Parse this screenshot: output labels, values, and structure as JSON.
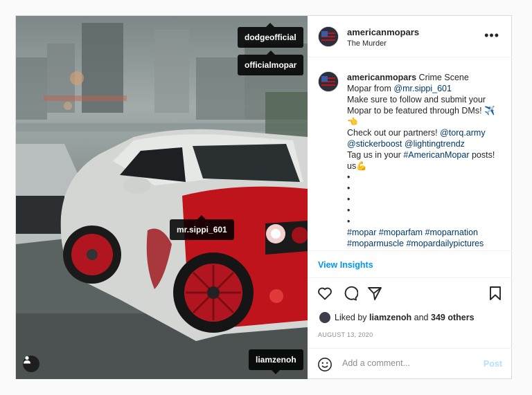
{
  "photo": {
    "tags": {
      "tag1": "dodgeofficial",
      "tag2": "officialmopar",
      "tag3": "mr.sippi_601",
      "tag4": "liamzenoh"
    },
    "user_tag_icon": "person-icon"
  },
  "header": {
    "username": "americanmopars",
    "location": "The Murder",
    "more_icon": "more-horizontal-icon",
    "more_label": "•••"
  },
  "caption": {
    "username": "americanmopars",
    "line1": "Crime Scene",
    "line2": "Mopar from",
    "mention1": "@mr.sippi_601",
    "line3": "Make sure to follow and submit your Mopar to be featured through DMs! ✈️",
    "emoji_point": "👈",
    "line4": "Check out our partners!",
    "mention2": "@torq.army",
    "mention3": "@stickerboost",
    "mention4": "@lightingtrendz",
    "line5": "Tag us in your",
    "hashtag_main": "#AmericanMopar",
    "line6": "posts!",
    "line7": "us",
    "emoji_flex": "💪",
    "dots": "•",
    "hashtags_line1": "#mopar #moparfam #moparnation",
    "hashtags_line2": "#moparmuscle #mopardailypictures"
  },
  "insights": "View Insights",
  "likes": {
    "prefix": "Liked by",
    "user": "liamzenoh",
    "middle": "and",
    "others": "349 others"
  },
  "date": "AUGUST 13, 2020",
  "comment": {
    "placeholder": "Add a comment...",
    "post_label": "Post"
  },
  "colors": {
    "accent": "#0095f6",
    "post_disabled": "#b2dffc",
    "link": "#00376b",
    "car_red": "#c0141c"
  }
}
